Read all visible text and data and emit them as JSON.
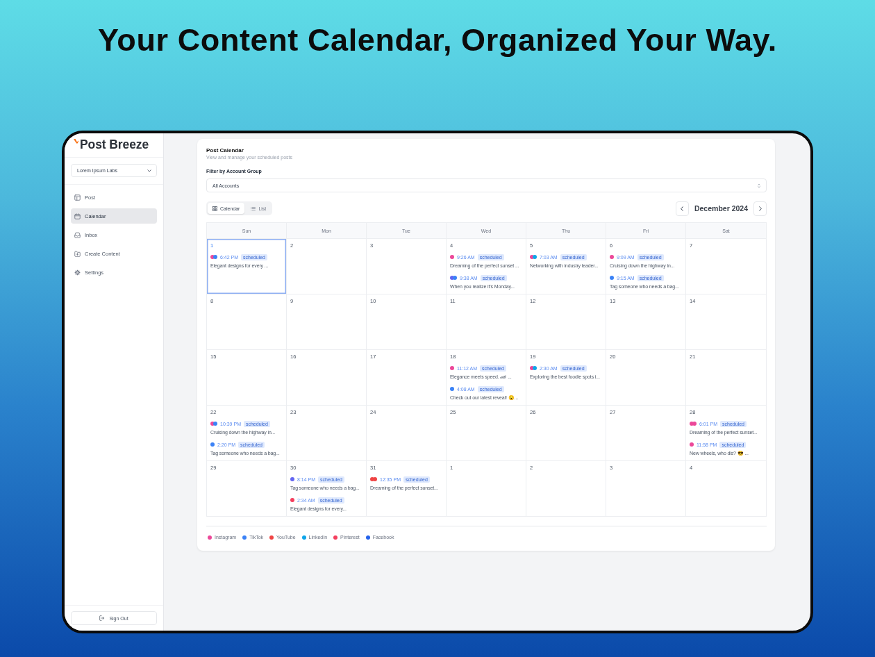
{
  "headline": "Your Content Calendar, Organized Your Way.",
  "sidebar": {
    "logo": "Post Breeze",
    "account": "Lorem Ipsum Labs",
    "items": [
      {
        "label": "Post",
        "selected": false
      },
      {
        "label": "Calendar",
        "selected": true
      },
      {
        "label": "Inbox",
        "selected": false
      },
      {
        "label": "Create Content",
        "selected": false
      },
      {
        "label": "Settings",
        "selected": false
      }
    ],
    "sign_out": "Sign Out"
  },
  "header": {
    "title": "Post Calendar",
    "subtitle": "View and manage your scheduled posts"
  },
  "filter": {
    "label": "Filter by Account Group",
    "value": "All Accounts"
  },
  "view_toggle": [
    {
      "label": "Calendar",
      "selected": true
    },
    {
      "label": "List",
      "selected": false
    }
  ],
  "month": "December 2024",
  "weekdays": [
    "Sun",
    "Mon",
    "Tue",
    "Wed",
    "Thu",
    "Fri",
    "Sat"
  ],
  "weeks": [
    {
      "days": [
        {
          "date": "1",
          "selected": true,
          "events": [
            {
              "time": "6:42 PM",
              "status": "scheduled",
              "title": "Elegant designs for every ...",
              "dots": [
                {
                  "color": "#ec4899"
                },
                {
                  "color": "#3b82f6"
                }
              ]
            }
          ]
        },
        {
          "date": "2",
          "selected": false
        },
        {
          "date": "3",
          "selected": false
        },
        {
          "date": "4",
          "selected": false,
          "events": [
            {
              "time": "9:26 AM",
              "status": "scheduled",
              "title": "Dreaming of the perfect sunset ...",
              "dots": [
                {
                  "color": "#ec4899"
                }
              ]
            },
            {
              "time": "9:38 AM",
              "status": "scheduled",
              "title": "When you realize it's Monday...",
              "dots": [
                {
                  "color": "#6366f1"
                },
                {
                  "color": "#3b82f6"
                }
              ]
            }
          ]
        },
        {
          "date": "5",
          "selected": false,
          "events": [
            {
              "time": "7:03 AM",
              "status": "scheduled",
              "title": "Networking with industry leader...",
              "dots": [
                {
                  "color": "#ec4899"
                },
                {
                  "color": "#0ea5e9"
                }
              ]
            }
          ]
        },
        {
          "date": "6",
          "selected": false,
          "events": [
            {
              "time": "9:09 AM",
              "status": "scheduled",
              "title": "Cruising down the highway in...",
              "dots": [
                {
                  "color": "#ec4899"
                }
              ]
            },
            {
              "time": "9:15 AM",
              "status": "scheduled",
              "title": "Tag someone who needs a bag...",
              "dots": [
                {
                  "color": "#3b82f6"
                }
              ]
            }
          ]
        },
        {
          "date": "7",
          "selected": false
        }
      ]
    },
    {
      "days": [
        {
          "date": "8",
          "selected": false
        },
        {
          "date": "9",
          "selected": false
        },
        {
          "date": "10",
          "selected": false
        },
        {
          "date": "11",
          "selected": false
        },
        {
          "date": "12",
          "selected": false
        },
        {
          "date": "13",
          "selected": false
        },
        {
          "date": "14",
          "selected": false
        }
      ]
    },
    {
      "days": [
        {
          "date": "15",
          "selected": false
        },
        {
          "date": "16",
          "selected": false
        },
        {
          "date": "17",
          "selected": false
        },
        {
          "date": "18",
          "selected": false,
          "events": [
            {
              "time": "11:12 AM",
              "status": "scheduled",
              "title": "Elegance meets speed. 🏎 ...",
              "dots": [
                {
                  "color": "#ec4899"
                }
              ]
            },
            {
              "time": "4:08 AM",
              "status": "scheduled",
              "title": "Check out our latest reveal! 😮...",
              "dots": [
                {
                  "color": "#3b82f6"
                }
              ]
            }
          ]
        },
        {
          "date": "19",
          "selected": false,
          "events": [
            {
              "time": "2:30 AM",
              "status": "scheduled",
              "title": "Exploring the best foodie spots i...",
              "dots": [
                {
                  "color": "#ec4899"
                },
                {
                  "color": "#0ea5e9"
                }
              ]
            }
          ]
        },
        {
          "date": "20",
          "selected": false
        },
        {
          "date": "21",
          "selected": false
        }
      ]
    },
    {
      "days": [
        {
          "date": "22",
          "selected": false,
          "events": [
            {
              "time": "10:39 PM",
              "status": "scheduled",
              "title": "Cruising down the highway in...",
              "dots": [
                {
                  "color": "#ec4899"
                },
                {
                  "color": "#3b82f6"
                }
              ]
            },
            {
              "time": "2:20 PM",
              "status": "scheduled",
              "title": "Tag someone who needs a bag...",
              "dots": [
                {
                  "color": "#3b82f6"
                }
              ]
            }
          ]
        },
        {
          "date": "23",
          "selected": false
        },
        {
          "date": "24",
          "selected": false
        },
        {
          "date": "25",
          "selected": false
        },
        {
          "date": "26",
          "selected": false
        },
        {
          "date": "27",
          "selected": false
        },
        {
          "date": "28",
          "selected": false,
          "events": [
            {
              "time": "6:01 PM",
              "status": "scheduled",
              "title": "Dreaming of the perfect sunset...",
              "dots": [
                {
                  "color": "#ec4899"
                },
                {
                  "color": "#ec4899"
                }
              ]
            },
            {
              "time": "11:58 PM",
              "status": "scheduled",
              "title": "New wheels, who dis? 😎 ...",
              "dots": [
                {
                  "color": "#ec4899"
                }
              ]
            }
          ]
        }
      ]
    },
    {
      "days": [
        {
          "date": "29",
          "selected": false
        },
        {
          "date": "30",
          "selected": false,
          "events": [
            {
              "time": "8:14 PM",
              "status": "scheduled",
              "title": "Tag someone who needs a bag...",
              "dots": [
                {
                  "color": "#6366f1"
                }
              ]
            },
            {
              "time": "2:34 AM",
              "status": "scheduled",
              "title": "Elegant designs for every...",
              "dots": [
                {
                  "color": "#f43f5e"
                }
              ]
            }
          ]
        },
        {
          "date": "31",
          "selected": false,
          "events": [
            {
              "time": "12:35 PM",
              "status": "scheduled",
              "title": "Dreaming of the perfect sunset...",
              "dots": [
                {
                  "color": "#ef4444"
                },
                {
                  "color": "#ef4444"
                }
              ]
            }
          ]
        },
        {
          "date": "1",
          "selected": false
        },
        {
          "date": "2",
          "selected": false
        },
        {
          "date": "3",
          "selected": false
        },
        {
          "date": "4",
          "selected": false
        }
      ]
    }
  ],
  "legend": [
    {
      "label": "Instagram",
      "color": "#ec4899"
    },
    {
      "label": "TikTok",
      "color": "#3b82f6"
    },
    {
      "label": "YouTube",
      "color": "#ef4444"
    },
    {
      "label": "LinkedIn",
      "color": "#0ea5e9"
    },
    {
      "label": "Pinterest",
      "color": "#f43f5e"
    },
    {
      "label": "Facebook",
      "color": "#2563eb"
    }
  ]
}
